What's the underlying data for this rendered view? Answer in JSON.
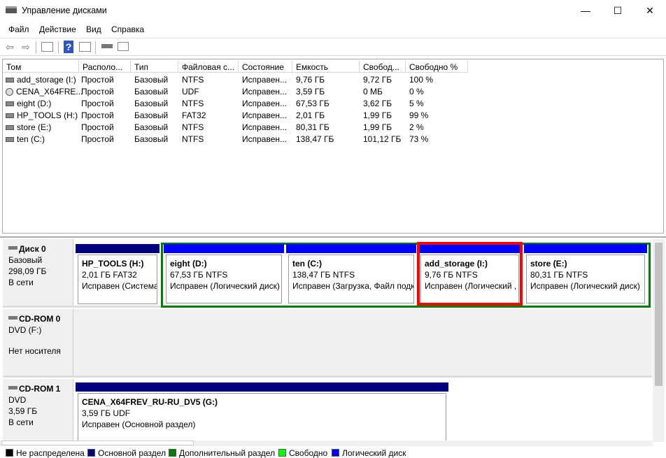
{
  "window": {
    "title": "Управление дисками",
    "minimize": "—",
    "maximize": "☐",
    "close": "✕"
  },
  "menu": [
    "Файл",
    "Действие",
    "Вид",
    "Справка"
  ],
  "toolbar": {
    "icons": [
      "back-arrow-icon",
      "forward-arrow-icon",
      "console-tree-icon",
      "help-icon",
      "action-pane-icon",
      "connect-disk-icon",
      "properties-list-icon"
    ],
    "help": "?"
  },
  "table": {
    "columns": [
      "Том",
      "Располо...",
      "Тип",
      "Файловая с...",
      "Состояние",
      "Емкость",
      "Свобод...",
      "Свободно %"
    ],
    "rows": [
      [
        "add_storage (I:)",
        "Простой",
        "Базовый",
        "NTFS",
        "Исправен...",
        "9,76 ГБ",
        "9,72 ГБ",
        "100 %"
      ],
      [
        "CENA_X64FRE...",
        "Простой",
        "Базовый",
        "UDF",
        "Исправен...",
        "3,59 ГБ",
        "0 МБ",
        "0 %"
      ],
      [
        "eight (D:)",
        "Простой",
        "Базовый",
        "NTFS",
        "Исправен...",
        "67,53 ГБ",
        "3,62 ГБ",
        "5 %"
      ],
      [
        "HP_TOOLS (H:)",
        "Простой",
        "Базовый",
        "FAT32",
        "Исправен...",
        "2,01 ГБ",
        "1,99 ГБ",
        "99 %"
      ],
      [
        "store (E:)",
        "Простой",
        "Базовый",
        "NTFS",
        "Исправен...",
        "80,31 ГБ",
        "1,99 ГБ",
        "2 %"
      ],
      [
        "ten (C:)",
        "Простой",
        "Базовый",
        "NTFS",
        "Исправен...",
        "138,47 ГБ",
        "101,12 ГБ",
        "73 %"
      ]
    ]
  },
  "disks": [
    {
      "name": "Диск 0",
      "type": "Базовый",
      "size": "298,09 ГБ",
      "status": "В сети",
      "partitions": [
        {
          "title": "HP_TOOLS  (H:)",
          "size": "2,01 ГБ FAT32",
          "status": "Исправен (Система"
        },
        {
          "title": "eight  (D:)",
          "size": "67,53 ГБ NTFS",
          "status": "Исправен (Логический диск)"
        },
        {
          "title": "ten  (C:)",
          "size": "138,47 ГБ NTFS",
          "status": "Исправен (Загрузка, Файл подк"
        },
        {
          "title": "add_storage  (I:)",
          "size": "9,76 ГБ NTFS",
          "status": "Исправен (Логический ,"
        },
        {
          "title": "store  (E:)",
          "size": "80,31 ГБ NTFS",
          "status": "Исправен (Логический диск)"
        }
      ]
    },
    {
      "name": "CD-ROM 0",
      "type": "DVD (F:)",
      "status": "Нет носителя"
    },
    {
      "name": "CD-ROM 1",
      "type": "DVD",
      "size": "3,59 ГБ",
      "status": "В сети",
      "partitions": [
        {
          "title": "CENA_X64FREV_RU-RU_DV5  (G:)",
          "size": "3,59 ГБ UDF",
          "status": "Исправен (Основной раздел)"
        }
      ]
    }
  ],
  "legend": [
    {
      "label": "Не распределена",
      "color": "#000000"
    },
    {
      "label": "Основной раздел",
      "color": "#000080"
    },
    {
      "label": "Дополнительный раздел",
      "color": "#008000"
    },
    {
      "label": "Свободно",
      "color": "#00ff00"
    },
    {
      "label": "Логический диск",
      "color": "#0000ff"
    }
  ],
  "colors": {
    "primary": "#000080",
    "logical": "#0000ff",
    "extended": "#008000",
    "selection": "#ff0000"
  }
}
